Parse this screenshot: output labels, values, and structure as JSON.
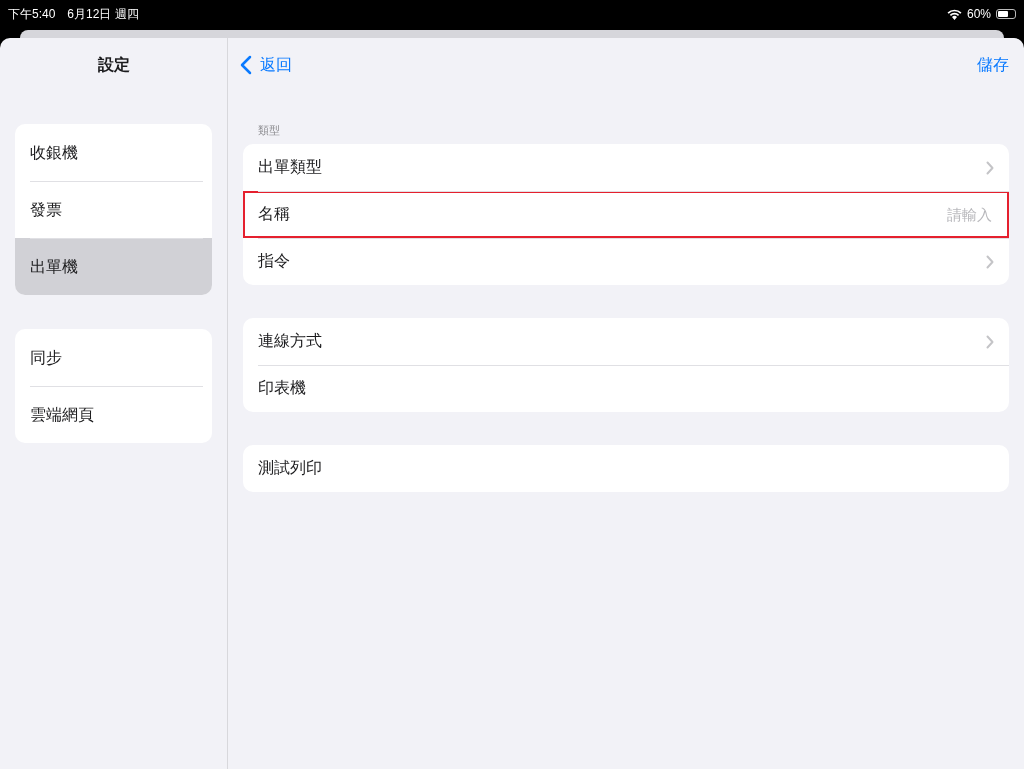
{
  "status_bar": {
    "time": "下午5:40",
    "date": "6月12日 週四",
    "battery": "60%"
  },
  "sidebar": {
    "title": "設定",
    "groups": [
      {
        "items": [
          {
            "label": "收銀機",
            "selected": false
          },
          {
            "label": "發票",
            "selected": false
          },
          {
            "label": "出單機",
            "selected": true
          }
        ]
      },
      {
        "items": [
          {
            "label": "同步",
            "selected": false
          },
          {
            "label": "雲端網頁",
            "selected": false
          }
        ]
      }
    ]
  },
  "nav": {
    "back": "返回",
    "action": "儲存"
  },
  "sections": [
    {
      "header": "類型",
      "rows": [
        {
          "kind": "chevron",
          "label": "出單類型",
          "highlighted": false
        },
        {
          "kind": "field",
          "label": "名稱",
          "placeholder": "請輸入",
          "highlighted": true
        },
        {
          "kind": "chevron",
          "label": "指令",
          "highlighted": false
        }
      ]
    },
    {
      "rows": [
        {
          "kind": "chevron",
          "label": "連線方式",
          "highlighted": false
        },
        {
          "kind": "plain",
          "label": "印表機",
          "highlighted": false
        }
      ]
    },
    {
      "rows": [
        {
          "kind": "plain",
          "label": "測試列印",
          "highlighted": false
        }
      ]
    }
  ]
}
